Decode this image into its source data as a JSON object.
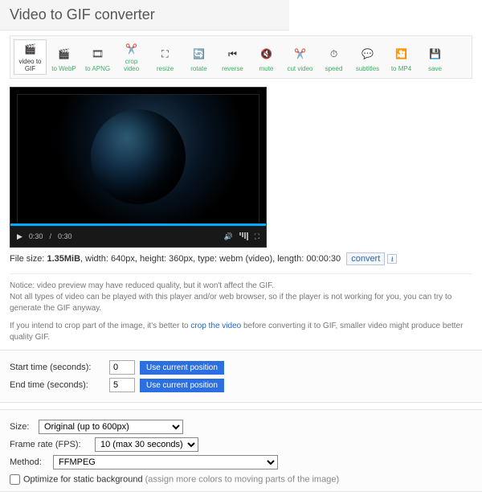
{
  "title": "Video to GIF converter",
  "toolbar": [
    {
      "label": "video to\nGIF",
      "name": "video-to-gif",
      "active": true
    },
    {
      "label": "to WebP",
      "name": "to-webp"
    },
    {
      "label": "to APNG",
      "name": "to-apng"
    },
    {
      "label": "crop video",
      "name": "crop-video"
    },
    {
      "label": "resize",
      "name": "resize"
    },
    {
      "label": "rotate",
      "name": "rotate"
    },
    {
      "label": "reverse",
      "name": "reverse"
    },
    {
      "label": "mute",
      "name": "mute"
    },
    {
      "label": "cut video",
      "name": "cut-video"
    },
    {
      "label": "speed",
      "name": "speed"
    },
    {
      "label": "subtitles",
      "name": "subtitles"
    },
    {
      "label": "to MP4",
      "name": "to-mp4"
    },
    {
      "label": "save",
      "name": "save"
    }
  ],
  "player": {
    "current": "0:30",
    "duration": "0:30"
  },
  "fileinfo": {
    "prefix": "File size: ",
    "size": "1.35MiB",
    "rest": ", width: 640px, height: 360px, type: webm (video), length: 00:00:30",
    "convert": "convert"
  },
  "notice": {
    "p1": "Notice: video preview may have reduced quality, but it won't affect the GIF.\nNot all types of video can be played with this player and/or web browser, so if the player is not working for you, you can try to generate the GIF anyway.",
    "p2a": "If you intend to crop part of the image, it's better to ",
    "p2link": "crop the video",
    "p2b": " before converting it to GIF, smaller video might produce better quality GIF."
  },
  "time": {
    "start_label": "Start time (seconds):",
    "start_val": "0",
    "end_label": "End time (seconds):",
    "end_val": "5",
    "btn": "Use current position"
  },
  "opts": {
    "size_label": "Size:",
    "size_val": "Original (up to 600px)",
    "fps_label": "Frame rate (FPS):",
    "fps_val": "10 (max 30 seconds)",
    "method_label": "Method:",
    "method_val": "FFMPEG",
    "opt_label": "Optimize for static background ",
    "opt_hint": "(assign more colors to moving parts of the image)"
  }
}
